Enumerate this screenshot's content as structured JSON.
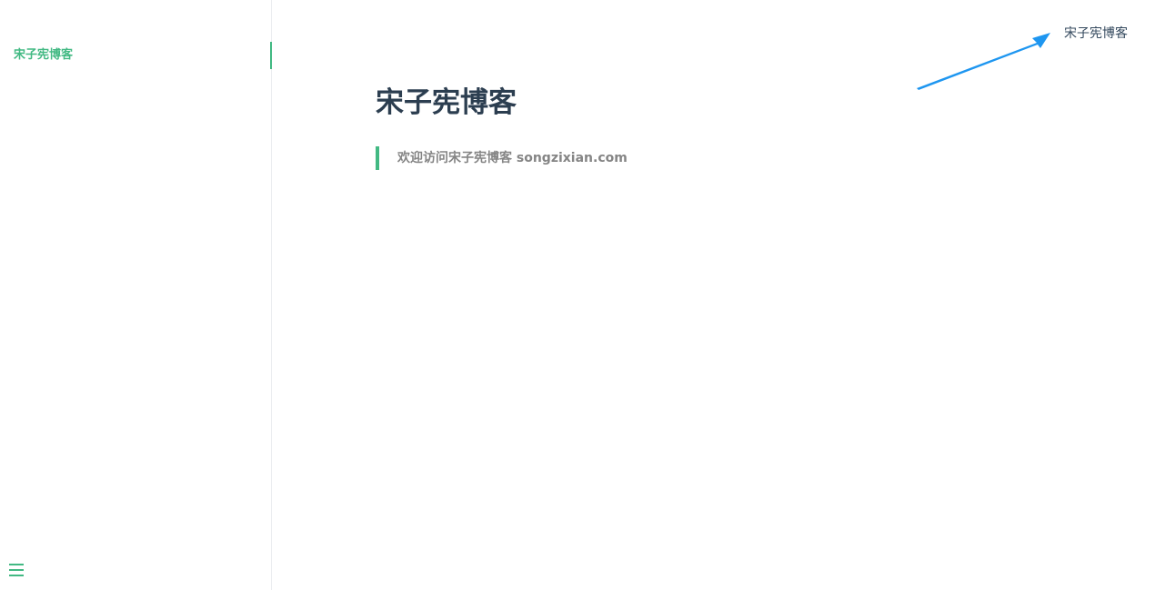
{
  "sidebar": {
    "items": [
      {
        "label": "宋子宪博客",
        "active": true
      }
    ],
    "menu_icon": "hamburger-menu-icon"
  },
  "top_nav": {
    "link_label": "宋子宪博客"
  },
  "main": {
    "title": "宋子宪博客",
    "blockquote": "欢迎访问宋子宪博客 songzixian.com"
  },
  "colors": {
    "accent": "#42b983",
    "title": "#2c3e50",
    "nav_text": "#34495e",
    "quote_text": "#858585",
    "annotation_arrow": "#1e96f0"
  }
}
